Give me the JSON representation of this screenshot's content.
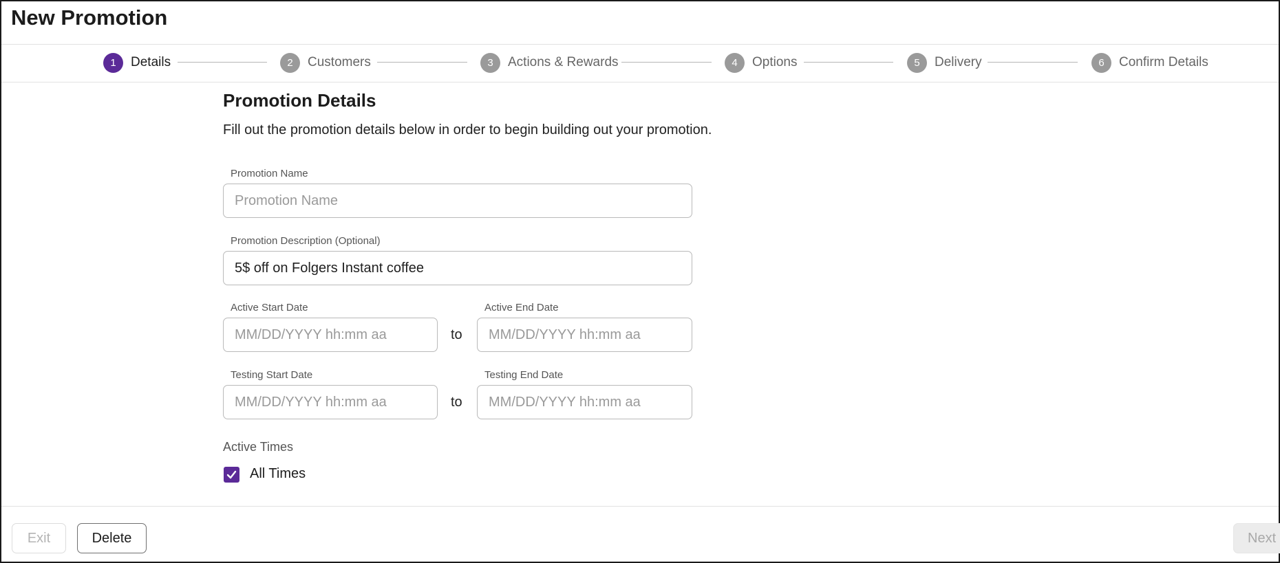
{
  "page": {
    "title": "New Promotion"
  },
  "stepper": {
    "steps": [
      {
        "number": "1",
        "label": "Details",
        "state": "active"
      },
      {
        "number": "2",
        "label": "Customers",
        "state": "inactive"
      },
      {
        "number": "3",
        "label": "Actions & Rewards",
        "state": "inactive"
      },
      {
        "number": "4",
        "label": "Options",
        "state": "inactive"
      },
      {
        "number": "5",
        "label": "Delivery",
        "state": "inactive"
      },
      {
        "number": "6",
        "label": "Confirm Details",
        "state": "inactive"
      }
    ]
  },
  "form": {
    "title": "Promotion Details",
    "description": "Fill out the promotion details below in order to begin building out your promotion.",
    "promotion_name": {
      "label": "Promotion Name",
      "value": "",
      "placeholder": "Promotion Name"
    },
    "promotion_description": {
      "label": "Promotion Description (Optional)",
      "value": "5$ off on Folgers Instant coffee",
      "placeholder": ""
    },
    "active_start": {
      "label": "Active Start Date",
      "value": "",
      "placeholder": "MM/DD/YYYY hh:mm aa"
    },
    "active_end": {
      "label": "Active End Date",
      "value": "",
      "placeholder": "MM/DD/YYYY hh:mm aa"
    },
    "testing_start": {
      "label": "Testing Start Date",
      "value": "",
      "placeholder": "MM/DD/YYYY hh:mm aa"
    },
    "testing_end": {
      "label": "Testing End Date",
      "value": "",
      "placeholder": "MM/DD/YYYY hh:mm aa"
    },
    "range_separator": "to",
    "active_times": {
      "label": "Active Times",
      "all_times_label": "All Times",
      "all_times_checked": true
    }
  },
  "footer": {
    "exit_label": "Exit",
    "delete_label": "Delete",
    "next_label": "Next"
  },
  "colors": {
    "accent": "#5b2a98",
    "step_inactive": "#9a9a9a",
    "border": "#b9b9b9"
  }
}
